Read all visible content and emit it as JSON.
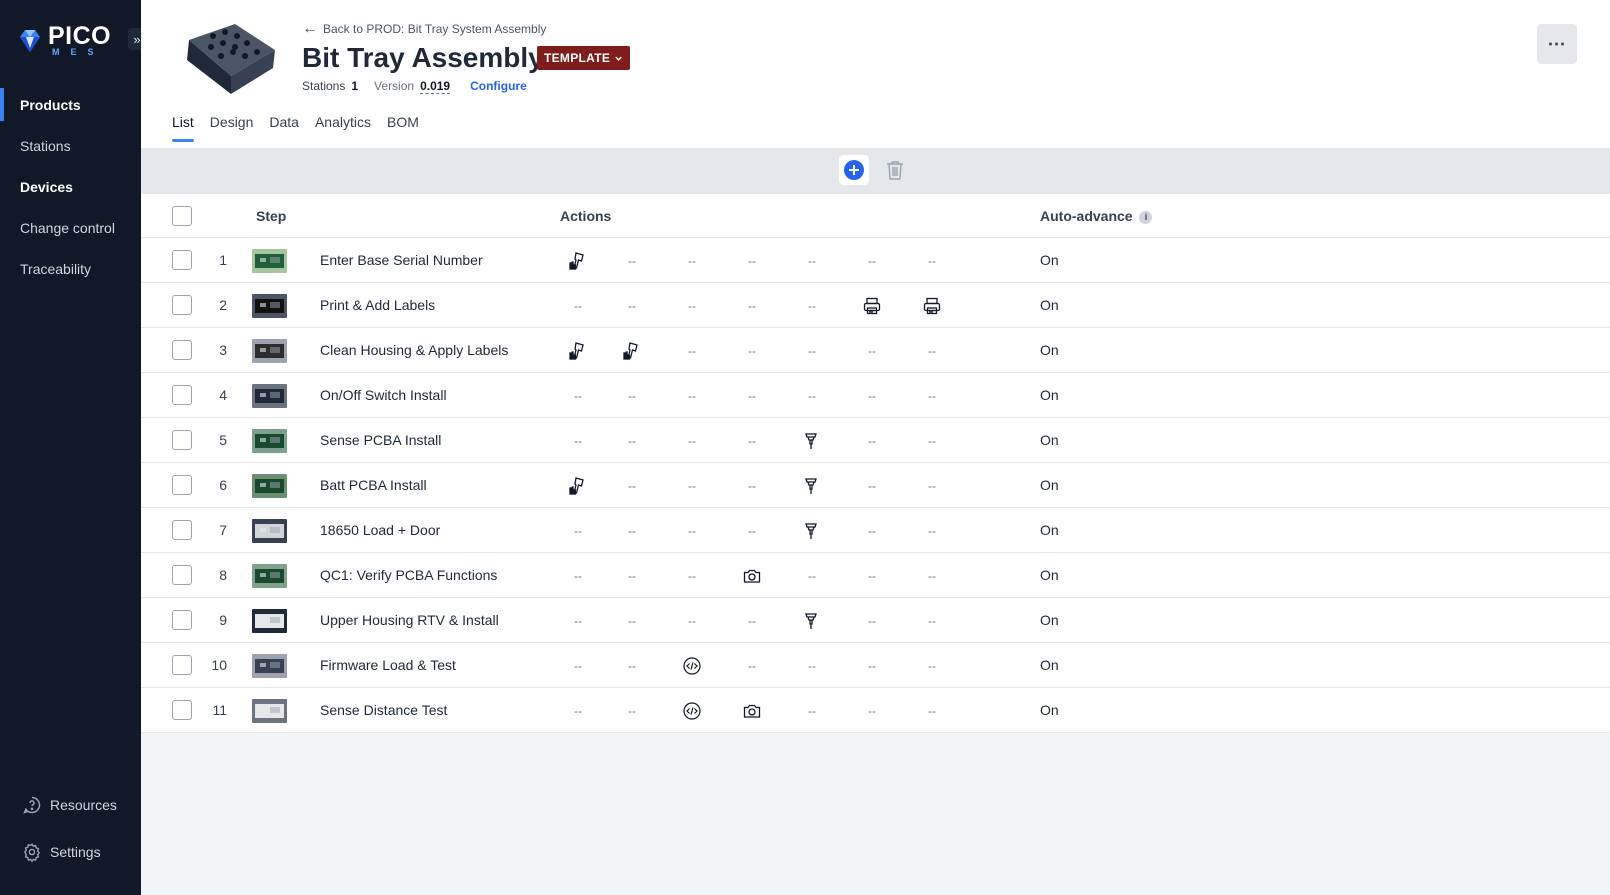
{
  "app": {
    "logo_word": "PICO",
    "logo_sub": "MES",
    "collapse_glyph": "»"
  },
  "sidebar": {
    "items": [
      {
        "label": "Products",
        "active": true
      },
      {
        "label": "Stations",
        "active": false
      },
      {
        "label": "Devices",
        "active": false
      },
      {
        "label": "Change control",
        "active": false
      },
      {
        "label": "Traceability",
        "active": false
      }
    ],
    "bottom": [
      {
        "label": "Resources",
        "icon": "help-circle-icon"
      },
      {
        "label": "Settings",
        "icon": "gear-icon"
      }
    ]
  },
  "header": {
    "back_label": "Back to PROD: Bit Tray System Assembly",
    "title": "Bit Tray Assembly",
    "badge": "TEMPLATE",
    "stations_label": "Stations",
    "stations_value": "1",
    "version_label": "Version",
    "version_value": "0.019",
    "configure_label": "Configure",
    "more_label": "⋯"
  },
  "tabs": [
    {
      "label": "List",
      "active": true
    },
    {
      "label": "Design",
      "active": false
    },
    {
      "label": "Data",
      "active": false
    },
    {
      "label": "Analytics",
      "active": false
    },
    {
      "label": "BOM",
      "active": false
    }
  ],
  "table": {
    "columns": {
      "step": "Step",
      "actions": "Actions",
      "auto_advance": "Auto-advance"
    },
    "empty_action": "--",
    "rows": [
      {
        "num": "1",
        "step": "Enter Base Serial Number",
        "actions": [
          "scanner",
          "",
          "",
          "",
          "",
          "",
          ""
        ],
        "auto": "On"
      },
      {
        "num": "2",
        "step": "Print & Add Labels",
        "actions": [
          "",
          "",
          "",
          "",
          "",
          "printer",
          "printer"
        ],
        "auto": "On"
      },
      {
        "num": "3",
        "step": "Clean Housing & Apply Labels",
        "actions": [
          "scanner",
          "scanner",
          "",
          "",
          "",
          "",
          ""
        ],
        "auto": "On"
      },
      {
        "num": "4",
        "step": "On/Off Switch Install",
        "actions": [
          "",
          "",
          "",
          "",
          "",
          "",
          ""
        ],
        "auto": "On"
      },
      {
        "num": "5",
        "step": "Sense PCBA Install",
        "actions": [
          "",
          "",
          "",
          "",
          "screwdriver",
          "",
          ""
        ],
        "auto": "On"
      },
      {
        "num": "6",
        "step": "Batt PCBA Install",
        "actions": [
          "scanner",
          "",
          "",
          "",
          "screwdriver",
          "",
          ""
        ],
        "auto": "On"
      },
      {
        "num": "7",
        "step": "18650 Load + Door",
        "actions": [
          "",
          "",
          "",
          "",
          "screwdriver",
          "",
          ""
        ],
        "auto": "On"
      },
      {
        "num": "8",
        "step": "QC1: Verify PCBA Functions",
        "actions": [
          "",
          "",
          "",
          "camera",
          "",
          "",
          ""
        ],
        "auto": "On"
      },
      {
        "num": "9",
        "step": "Upper Housing RTV & Install",
        "actions": [
          "",
          "",
          "",
          "",
          "screwdriver",
          "",
          ""
        ],
        "auto": "On"
      },
      {
        "num": "10",
        "step": "Firmware Load & Test",
        "actions": [
          "",
          "",
          "code",
          "",
          "",
          "",
          ""
        ],
        "auto": "On"
      },
      {
        "num": "11",
        "step": "Sense Distance Test",
        "actions": [
          "",
          "",
          "code",
          "camera",
          "",
          "",
          ""
        ],
        "auto": "On"
      }
    ]
  },
  "colors": {
    "sidebar_bg": "#111827",
    "accent": "#3b82f6",
    "badge_bg": "#7f1d1d",
    "link": "#2563eb"
  }
}
